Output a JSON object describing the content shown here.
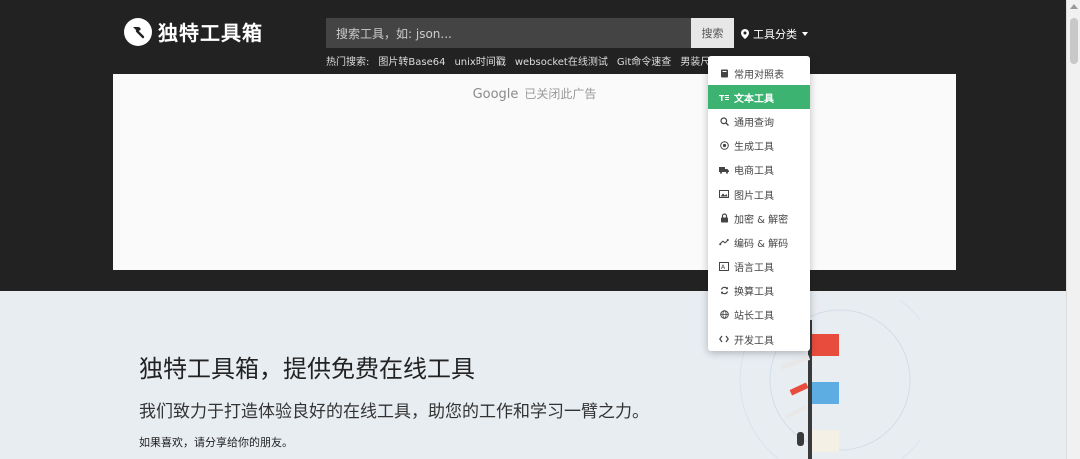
{
  "header": {
    "logo_text": "独特工具箱",
    "search_placeholder": "搜索工具，如: json...",
    "search_button": "搜索",
    "category_label": "工具分类",
    "hot_label": "热门搜索:",
    "hot_items": [
      "图片转Base64",
      "unix时间戳",
      "websocket在线测试",
      "Git命令速查",
      "男装尺码"
    ]
  },
  "ad": {
    "google_text": "Google",
    "closed_text": "已关闭此广告"
  },
  "dropdown": {
    "items": [
      {
        "label": "常用对照表",
        "icon": "book-icon"
      },
      {
        "label": "文本工具",
        "icon": "text-icon",
        "active": true
      },
      {
        "label": "通用查询",
        "icon": "search-icon"
      },
      {
        "label": "生成工具",
        "icon": "target-icon"
      },
      {
        "label": "电商工具",
        "icon": "truck-icon"
      },
      {
        "label": "图片工具",
        "icon": "image-icon"
      },
      {
        "label": "加密 & 解密",
        "icon": "lock-icon"
      },
      {
        "label": "编码 & 解码",
        "icon": "code-fork-icon"
      },
      {
        "label": "语言工具",
        "icon": "language-icon"
      },
      {
        "label": "换算工具",
        "icon": "refresh-icon"
      },
      {
        "label": "站长工具",
        "icon": "globe-icon"
      },
      {
        "label": "开发工具",
        "icon": "code-icon"
      }
    ]
  },
  "hero": {
    "title": "独特工具箱，提供免费在线工具",
    "subtitle": "我们致力于打造体验良好的在线工具，助您的工作和学习一臂之力。",
    "share": "如果喜欢，请分享给你的朋友。"
  },
  "colors": {
    "header_bg": "#232222",
    "accent_green": "#3cb371",
    "hero_bg": "#e8edf2"
  }
}
